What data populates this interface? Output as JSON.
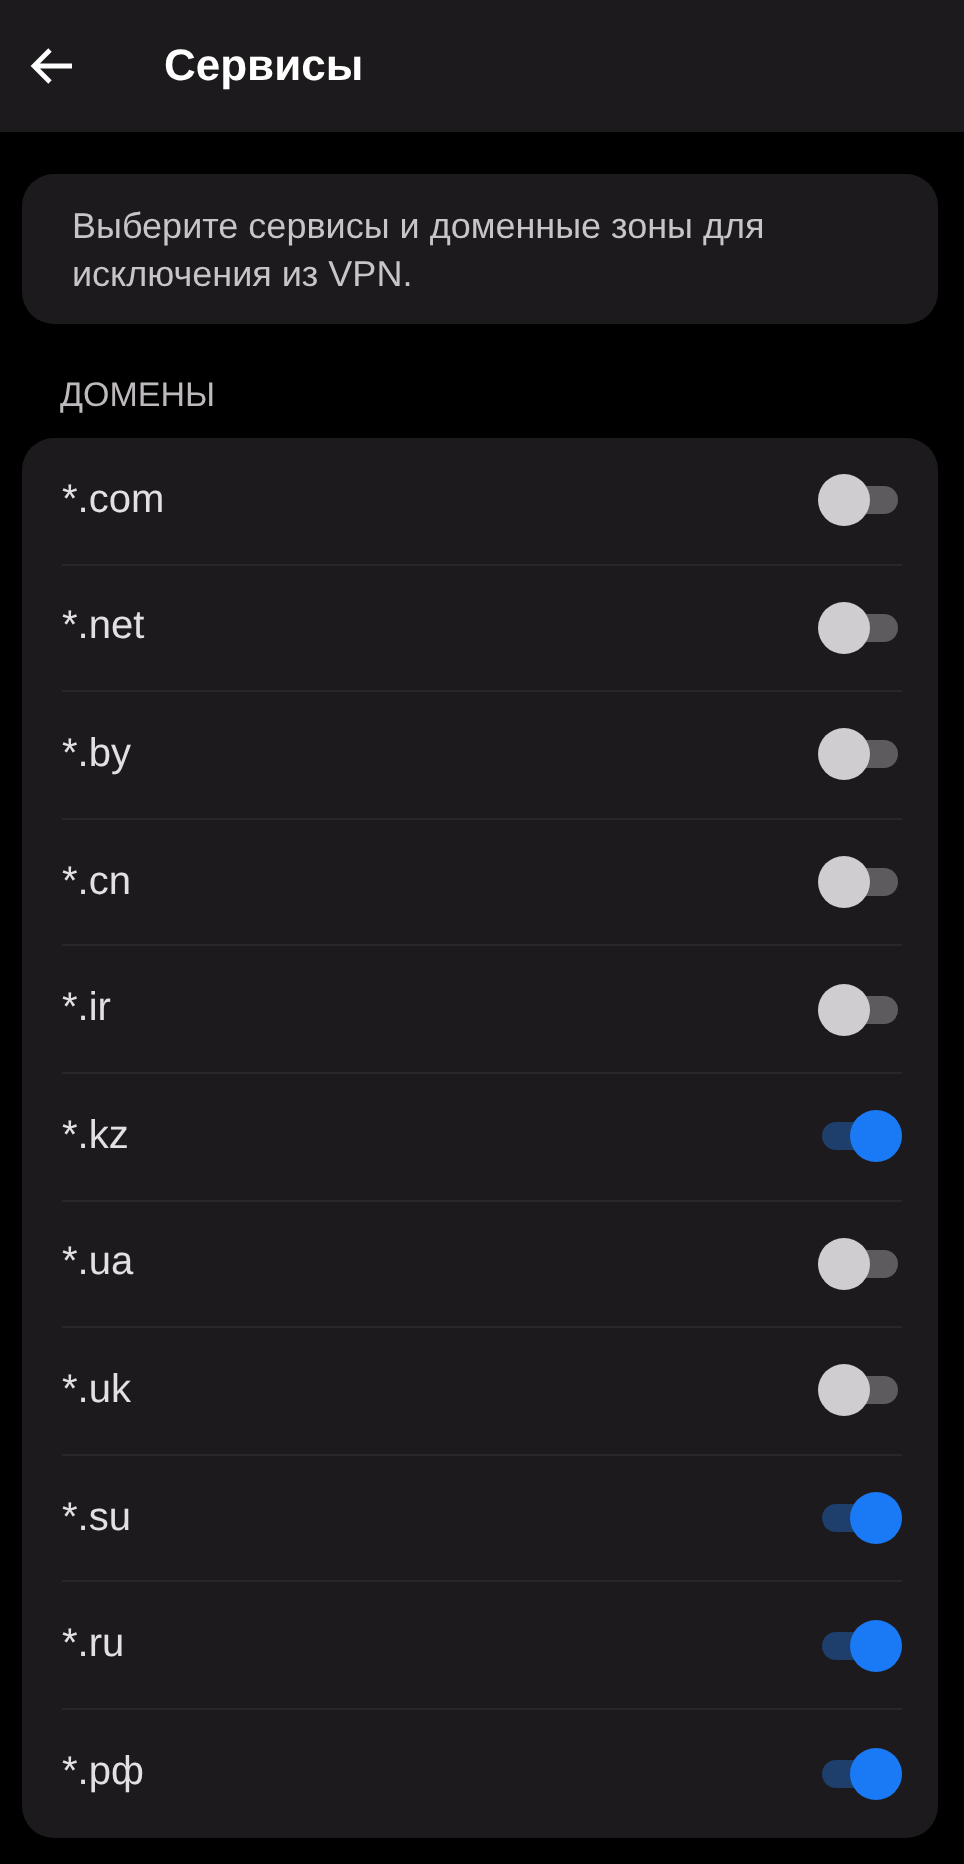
{
  "header": {
    "title": "Сервисы"
  },
  "info": {
    "text": "Выберите сервисы и доменные зоны для исключения из VPN."
  },
  "section": {
    "title": "ДОМЕНЫ"
  },
  "domains": [
    {
      "label": "*.com",
      "on": false
    },
    {
      "label": "*.net",
      "on": false
    },
    {
      "label": "*.by",
      "on": false
    },
    {
      "label": "*.cn",
      "on": false
    },
    {
      "label": "*.ir",
      "on": false
    },
    {
      "label": "*.kz",
      "on": true
    },
    {
      "label": "*.ua",
      "on": false
    },
    {
      "label": "*.uk",
      "on": false
    },
    {
      "label": "*.su",
      "on": true
    },
    {
      "label": "*.ru",
      "on": true
    },
    {
      "label": "*.рф",
      "on": true
    }
  ]
}
